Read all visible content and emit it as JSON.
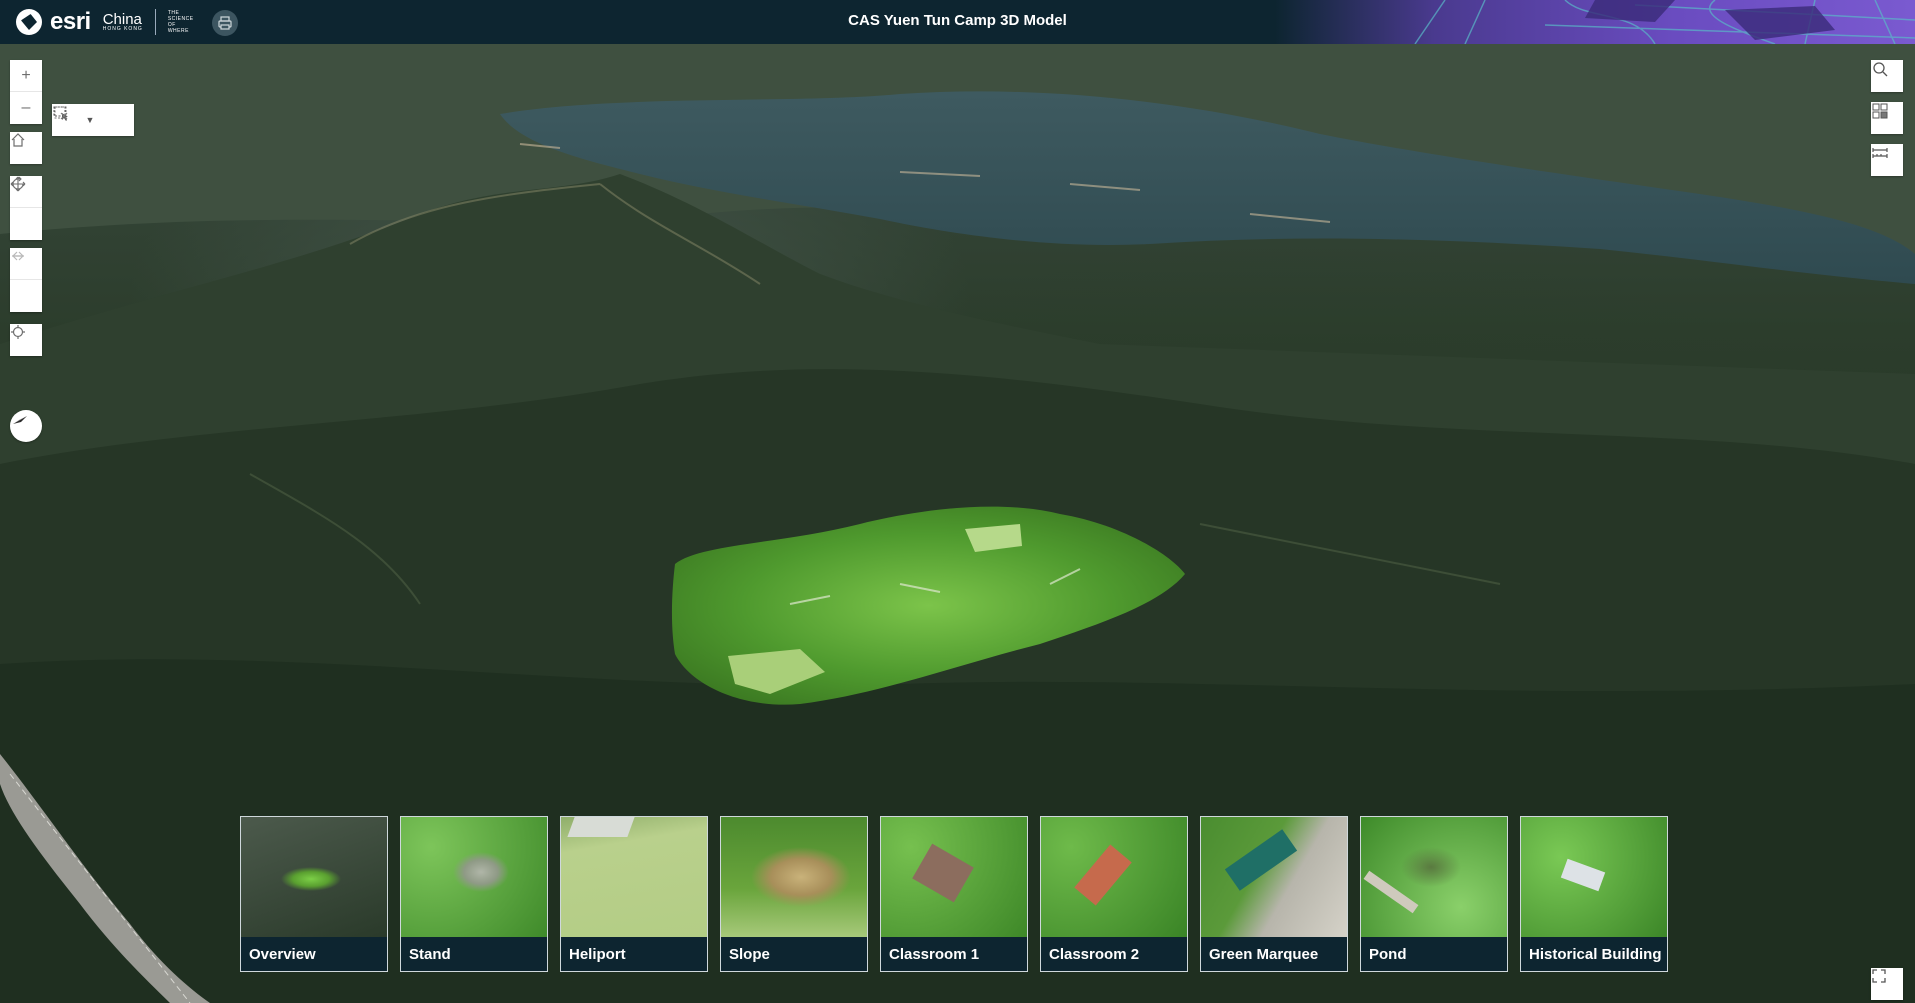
{
  "header": {
    "brand_esri": "esri",
    "brand_china": "China",
    "brand_hk": "HONG KONG",
    "brand_science": [
      "THE",
      "SCIENCE",
      "OF",
      "WHERE"
    ],
    "title": "CAS Yuen Tun Camp 3D Model",
    "print_icon": "printer-icon"
  },
  "left_toolbar": {
    "navigation": [
      "zoom-in-icon",
      "zoom-out-icon"
    ],
    "home": "home-icon",
    "modes": [
      "pan-icon",
      "rotate-icon"
    ],
    "history": [
      "undo-arrow-icon",
      "redo-arrow-icon"
    ],
    "locate": "locate-icon",
    "compass": "compass-icon",
    "select": [
      "select-rectangle-icon",
      "dropdown-caret-icon",
      "clear-selection-icon"
    ],
    "zoom_in_label": "+",
    "zoom_out_label": "–"
  },
  "right_toolbar": [
    "search-icon",
    "basemap-gallery-icon",
    "measure-icon"
  ],
  "fullscreen": "fullscreen-icon",
  "slides": [
    {
      "label": "Overview",
      "theme": "overview"
    },
    {
      "label": "Stand",
      "theme": "stand"
    },
    {
      "label": "Heliport",
      "theme": "heliport"
    },
    {
      "label": "Slope",
      "theme": "slope"
    },
    {
      "label": "Classroom 1",
      "theme": "classroom1"
    },
    {
      "label": "Classroom 2",
      "theme": "classroom2"
    },
    {
      "label": "Green Marquee",
      "theme": "marquee"
    },
    {
      "label": "Pond",
      "theme": "pond"
    },
    {
      "label": "Historical Building",
      "theme": "historical"
    }
  ],
  "colors": {
    "header_bg": "#0d2530",
    "caption_bg": "#0d2530",
    "water": "#3d5f66",
    "forest": "#2c3d2c",
    "model_green": "#5fae3a"
  }
}
